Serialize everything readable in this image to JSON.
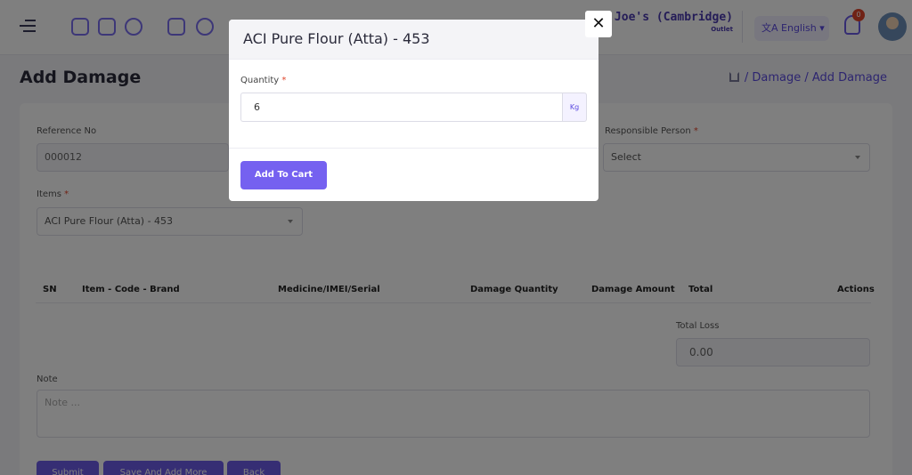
{
  "topbar": {
    "outlet_name": "er Joe's (Cambridge)",
    "outlet_sub": "Outlet",
    "language": "English",
    "notification_count": "0",
    "icons": [
      "menu-icon",
      "cart-icon",
      "calculator-icon",
      "box-icon",
      "report-icon",
      "target-icon"
    ]
  },
  "page": {
    "title": "Add Damage",
    "breadcrumb": "/ Damage / Add Damage"
  },
  "form": {
    "reference_label": "Reference No",
    "reference_value": "000012",
    "responsible_label": "Responsible Person",
    "responsible_value": "Select",
    "items_label": "Items",
    "items_value": "ACI Pure Flour (Atta) - 453",
    "table_headers": [
      "SN",
      "Item - Code - Brand",
      "Medicine/IMEI/Serial",
      "Damage Quantity",
      "Damage Amount",
      "Total",
      "Actions"
    ],
    "total_loss_label": "Total Loss",
    "total_loss_value": "0.00",
    "note_label": "Note",
    "note_placeholder": "Note ...",
    "buttons": [
      "Submit",
      "Save And Add More",
      "Back"
    ]
  },
  "modal": {
    "title": "ACI Pure Flour (Atta) - 453",
    "quantity_label": "Quantity",
    "quantity_value": "6",
    "unit": "Kg",
    "add_button": "Add To Cart",
    "close_glyph": "✕"
  },
  "colors": {
    "accent": "#7561f0",
    "required": "#e0452b"
  }
}
